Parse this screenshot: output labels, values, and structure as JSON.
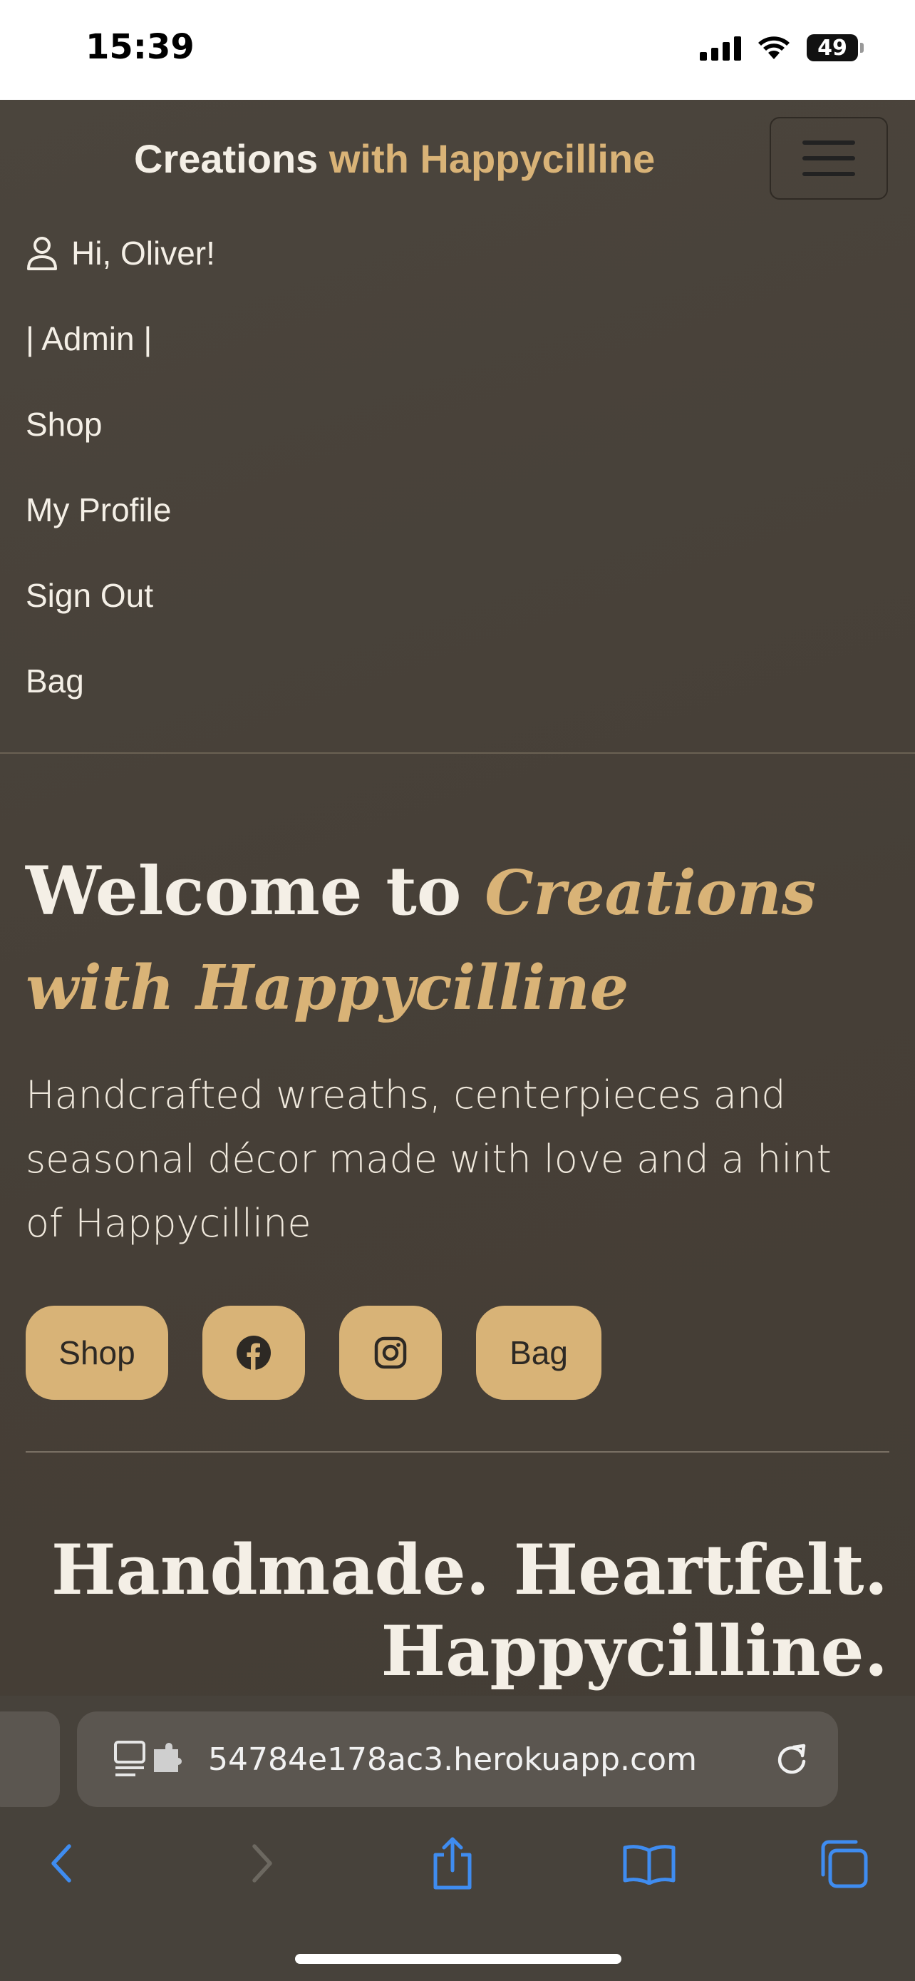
{
  "status_bar": {
    "time": "15:39",
    "battery": "49",
    "icons": [
      "cellular-signal-icon",
      "wifi-icon",
      "battery-icon"
    ]
  },
  "navbar": {
    "brand_main": "Creations",
    "brand_accent": " with Happycilline",
    "toggler_icon": "hamburger-menu-icon",
    "items": [
      {
        "label": "Hi, Oliver!",
        "icon": "user-icon"
      },
      {
        "label": "| Admin |"
      },
      {
        "label": "Shop"
      },
      {
        "label": "My Profile"
      },
      {
        "label": "Sign Out"
      },
      {
        "label": "Bag"
      }
    ]
  },
  "hero": {
    "title_prefix": "Welcome to ",
    "title_script": "Creations with Happycilline",
    "description": "Handcrafted wreaths, centerpieces and seasonal décor made with love and a hint of Happycilline",
    "buttons": {
      "shop": "Shop",
      "facebook_icon": "facebook-icon",
      "instagram_icon": "instagram-icon",
      "bag": "Bag"
    },
    "tagline_line1": "Handmade. Heartfelt.",
    "tagline_line2": "Happycilline."
  },
  "browser": {
    "url": "54784e178ac3.herokuapp.com",
    "icons": [
      "reader-extension-icon",
      "reload-icon",
      "back-icon",
      "forward-icon",
      "share-icon",
      "bookmarks-icon",
      "tabs-icon"
    ]
  },
  "colors": {
    "background": "#4a443c",
    "accent": "#d9b377",
    "button": "#d8b377",
    "ios_blue": "#3f8cf0"
  }
}
